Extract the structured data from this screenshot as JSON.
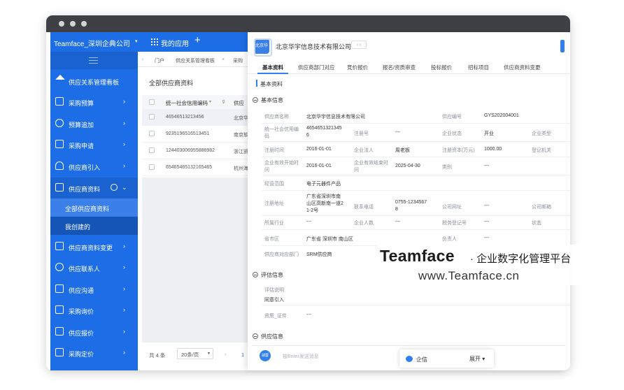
{
  "window": {
    "dot_color": "#d3d5d8"
  },
  "topnav": {
    "brand": "Teamface_深圳企典公司",
    "my_apps": "我的应用",
    "plus": "+",
    "caret": "▾"
  },
  "sidebar": {
    "items": [
      {
        "label": "供应关系管理看板"
      },
      {
        "label": "采购预算"
      },
      {
        "label": "预算追加"
      },
      {
        "label": "采购申请"
      },
      {
        "label": "供应商引入"
      },
      {
        "label": "供应商资料"
      },
      {
        "label": "供应商资料变更"
      },
      {
        "label": "供应联系人"
      },
      {
        "label": "供应沟通"
      },
      {
        "label": "采购询价"
      },
      {
        "label": "供应报价"
      },
      {
        "label": "采购定价"
      }
    ],
    "subitems": [
      {
        "label": "全部供应商资料"
      },
      {
        "label": "我创建的"
      }
    ]
  },
  "tabbar": {
    "tabs": [
      "门户",
      "供应关系管理看板",
      "采购"
    ],
    "close": "×"
  },
  "list": {
    "title": "全部供应商资料",
    "header": {
      "col1": "统一社会信用编码",
      "col2": "供应"
    },
    "rows": [
      {
        "code": "46546513213456",
        "name": "北京华"
      },
      {
        "code": "92351965165134​51",
        "name": "南京软"
      },
      {
        "code": "124403006955886982",
        "name": "浙江凯"
      },
      {
        "code": "65465465132165465",
        "name": "杭州海"
      }
    ],
    "pager": {
      "total": "共 4 条",
      "size": "20条/页",
      "page": "1"
    }
  },
  "detail": {
    "company": "北京华宇信息技术有限公司",
    "logo_text": "北京华宇",
    "tabs": [
      "基本资料",
      "供应商部门对应",
      "竞价报价",
      "报名/资质审查",
      "投标报价",
      "招标项目",
      "供应商资料变更"
    ],
    "section_label": "基本资料",
    "basic_title": "基本信息",
    "fields": {
      "supplier_name_l": "供应商名称",
      "supplier_name_v": "北京华宇信息技术有限公司",
      "supplier_no_l": "供应编号",
      "supplier_no_v": "GYS202004001",
      "credit_l1": "统一社会信用编",
      "credit_l2": "码",
      "credit_v1": "4654651321345",
      "credit_v2": "6",
      "reg_no_l": "注册号",
      "reg_no_v": "---",
      "status_l": "企业状态",
      "status_v": "开业",
      "type_l": "企业类型",
      "reg_time_l": "注册时间",
      "reg_time_v": "2016-01-01",
      "legal_l": "企业法人",
      "legal_v": "周老板",
      "capital_l": "注册资本(万元)",
      "capital_v": "1000.00",
      "authority_l": "登记机关",
      "valid_start_l1": "企业有效开始时",
      "valid_start_l2": "间",
      "valid_start_v": "2016-01-01",
      "valid_end_l1": "企业有效结束时",
      "valid_end_l2": "间",
      "valid_end_v": "2025-04-30",
      "category_l": "类别",
      "category_v": "---",
      "scope_l": "经营范围",
      "scope_v": "电子元器件产品",
      "address_l": "注册地址",
      "address_v1": "广东省深圳市南",
      "address_v2": "山区高新南一道2",
      "address_v3": "1-2号",
      "phone_l": "联系电话",
      "phone_v1": "0755-1234567",
      "phone_v2": "8",
      "website_l": "公司网址",
      "website_v": "---",
      "email_l": "公司邮箱",
      "industry_l": "所属行业",
      "industry_v": "---",
      "headcount_l": "企业人数",
      "headcount_v": "---",
      "tax_l": "税务登记号",
      "tax_v": "---",
      "state_l": "状态",
      "region_l": "省市区",
      "region_v": "广东省 深圳市 南山区",
      "owner_l": "负责人",
      "owner_v": "---",
      "dept_l": "供应商对应部门",
      "dept_v": "SRM供应商"
    },
    "eval_title": "评估信息",
    "eval": {
      "desc_l": "评估说明",
      "desc_v": "同意引入",
      "cert_l": "资质_证件",
      "cert_v": "---"
    },
    "supply_title": "供应信息",
    "chat": {
      "avatar": "胡蓉",
      "placeholder": "按Enter发送消息"
    }
  },
  "qixin": {
    "label": "企信",
    "expand": "展开 ▾"
  },
  "watermark": {
    "brand": "Teamface",
    "tagline": "· 企业数字化管理平台",
    "url": "www.Teamface.cn"
  }
}
